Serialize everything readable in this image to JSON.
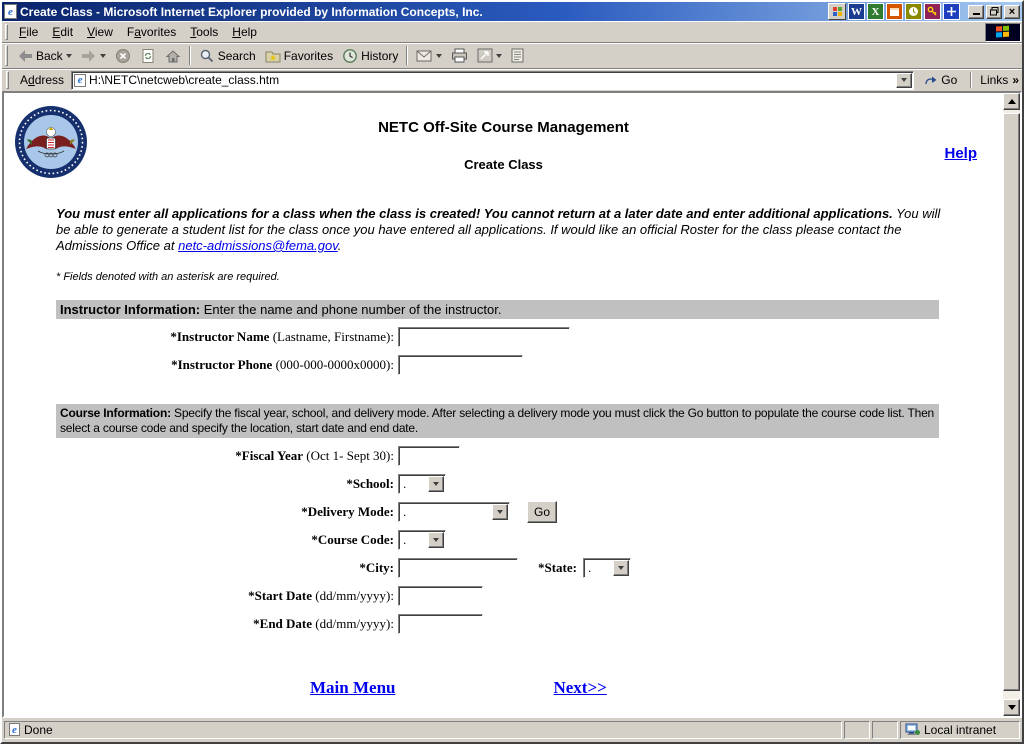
{
  "window_title": "Create Class - Microsoft Internet Explorer provided by Information Concepts, Inc.",
  "menu": {
    "items": [
      "File",
      "Edit",
      "View",
      "Favorites",
      "Tools",
      "Help"
    ]
  },
  "toolbar": {
    "back_label": "Back",
    "search_label": "Search",
    "favorites_label": "Favorites",
    "history_label": "History"
  },
  "address": {
    "label": "Address",
    "value": "H:\\NETC\\netcweb\\create_class.htm",
    "go_label": "Go",
    "links_label": "Links",
    "links_chevron": "»"
  },
  "page": {
    "heading": "NETC Off-Site Course Management",
    "subheading": "Create Class",
    "help_link": "Help",
    "intro_bold": "You must enter all applications for a class when the class is created! You cannot return at a later date and enter additional applications.",
    "intro_normal": " You will be able to generate a student list for the class once you have entered all applications. If would like an official Roster for the class please contact the Admissions Office at ",
    "intro_link": "netc-admissions@fema.gov",
    "intro_period": ".",
    "required_note": "* Fields denoted with an asterisk are required.",
    "instructor": {
      "header_bold": "Instructor Information:",
      "header_normal": "  Enter the name and phone number of the instructor.",
      "rows": [
        {
          "bold": "*Instructor Name",
          "normal": " (Lastname, Firstname):"
        },
        {
          "bold": "*Instructor Phone",
          "normal": " (000-000-0000x0000):"
        }
      ]
    },
    "course": {
      "header_bold": "Course Information:",
      "header_normal": " Specify the fiscal year, school, and delivery mode. After selecting a delivery mode you must click the Go button to populate the course code list. Then select a course code and specify the location, start date and end date.",
      "rows": [
        {
          "bold": "*Fiscal Year",
          "normal": " (Oct 1- Sept 30):"
        },
        {
          "bold": "*School:",
          "normal": ""
        },
        {
          "bold": "*Delivery Mode:",
          "normal": ""
        },
        {
          "bold": "*Course Code:",
          "normal": ""
        },
        {
          "bold": "*City:",
          "normal": ""
        },
        {
          "bold": "*Start Date",
          "normal": " (dd/mm/yyyy):"
        },
        {
          "bold": "*End Date",
          "normal": " (dd/mm/yyyy):"
        }
      ],
      "school_value": ".",
      "delivery_value": ".",
      "course_code_value": ".",
      "state_label": "*State:",
      "state_value": ".",
      "go_button": "Go"
    },
    "links": {
      "main_menu": "Main Menu",
      "next": "Next>>"
    }
  },
  "status": {
    "done": "Done",
    "zone": "Local intranet"
  },
  "colors": {
    "link_blue": "#0000ee",
    "section_gray": "#c0c0c0",
    "title_blue": "#0a246a"
  }
}
